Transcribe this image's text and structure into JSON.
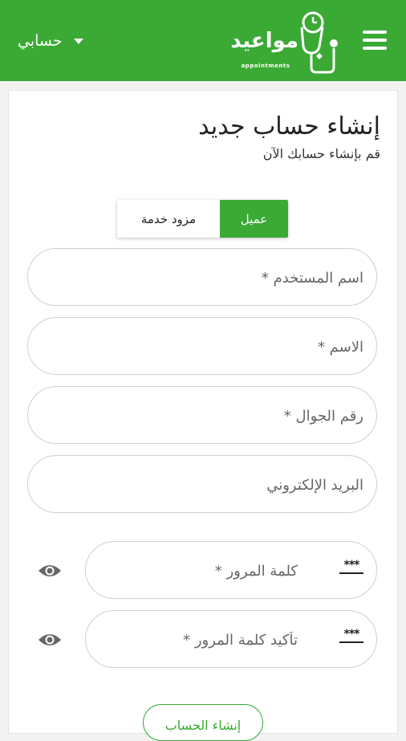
{
  "header": {
    "logo_text": "مواعيد",
    "logo_subtext": "appointments",
    "account_label": "حسابي",
    "colors": {
      "brand": "#3aaa35"
    }
  },
  "page": {
    "title": "إنشاء حساب جديد",
    "subtitle": "قم بإنشاء حسابك الآن"
  },
  "account_type": {
    "client_label": "عميل",
    "provider_label": "مزود خدمة",
    "selected": "عميل"
  },
  "form": {
    "username_placeholder": "اسم المستخدم *",
    "name_placeholder": "الاسم *",
    "mobile_placeholder": "رقم الجوال *",
    "email_placeholder": "البريد الإلكتروني",
    "password_placeholder": "كلمة المرور *",
    "confirm_password_placeholder": "تأكيد كلمة المرور *",
    "password_dots": "***",
    "submit_label": "إنشاء الحساب"
  }
}
